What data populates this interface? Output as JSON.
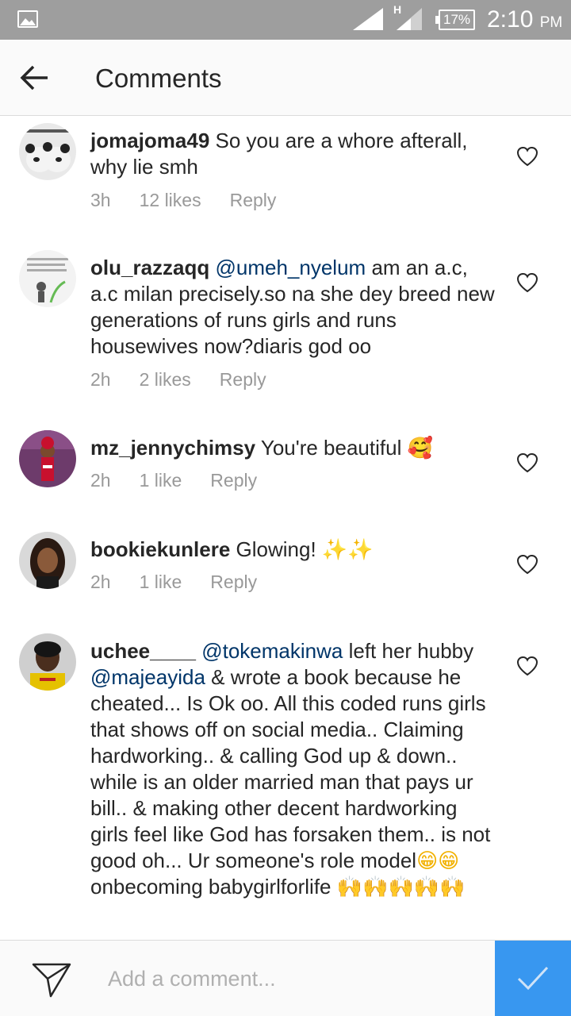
{
  "status_bar": {
    "network_label": "H",
    "battery": "17%",
    "time": "2:10",
    "ampm": "PM"
  },
  "header": {
    "title": "Comments"
  },
  "comments": [
    {
      "username": "jomajoma49",
      "text": "So you are a whore afterall, why lie smh",
      "time": "3h",
      "likes": "12 likes",
      "reply": "Reply"
    },
    {
      "username": "olu_razzaqq",
      "mention": "@umeh_nyelum",
      "text": "am an a.c, a.c milan precisely.so na she dey breed new generations of runs girls and runs housewives now?diaris god oo",
      "time": "2h",
      "likes": "2 likes",
      "reply": "Reply"
    },
    {
      "username": "mz_jennychimsy",
      "text": "You're beautiful",
      "emoji": "🥰",
      "time": "2h",
      "likes": "1 like",
      "reply": "Reply"
    },
    {
      "username": "bookiekunlere",
      "text": "Glowing!",
      "emoji": "✨✨",
      "time": "2h",
      "likes": "1 like",
      "reply": "Reply"
    },
    {
      "username": "uchee____",
      "mention": "@tokemakinwa",
      "text_a": "left her hubby",
      "mention2": "@majeayida",
      "text_b": "& wrote a book  because he cheated... Is Ok oo.  All this coded runs girls that shows off on social media.. Claiming hardworking.. & calling God up & down.. while is an older married man that pays ur bill.. & making other decent hardworking girls feel  like God has forsaken them.. is not good oh... Ur someone's role model",
      "emoji1": "😁😁",
      "text_c": "onbecoming babygirlforlife",
      "emoji2": "🙌🙌🙌🙌🙌"
    }
  ],
  "composer": {
    "placeholder": "Add a comment..."
  },
  "colors": {
    "status_bar": "#9e9e9e",
    "mention": "#003569",
    "meta": "#999999",
    "post_button": "#3897f0"
  }
}
